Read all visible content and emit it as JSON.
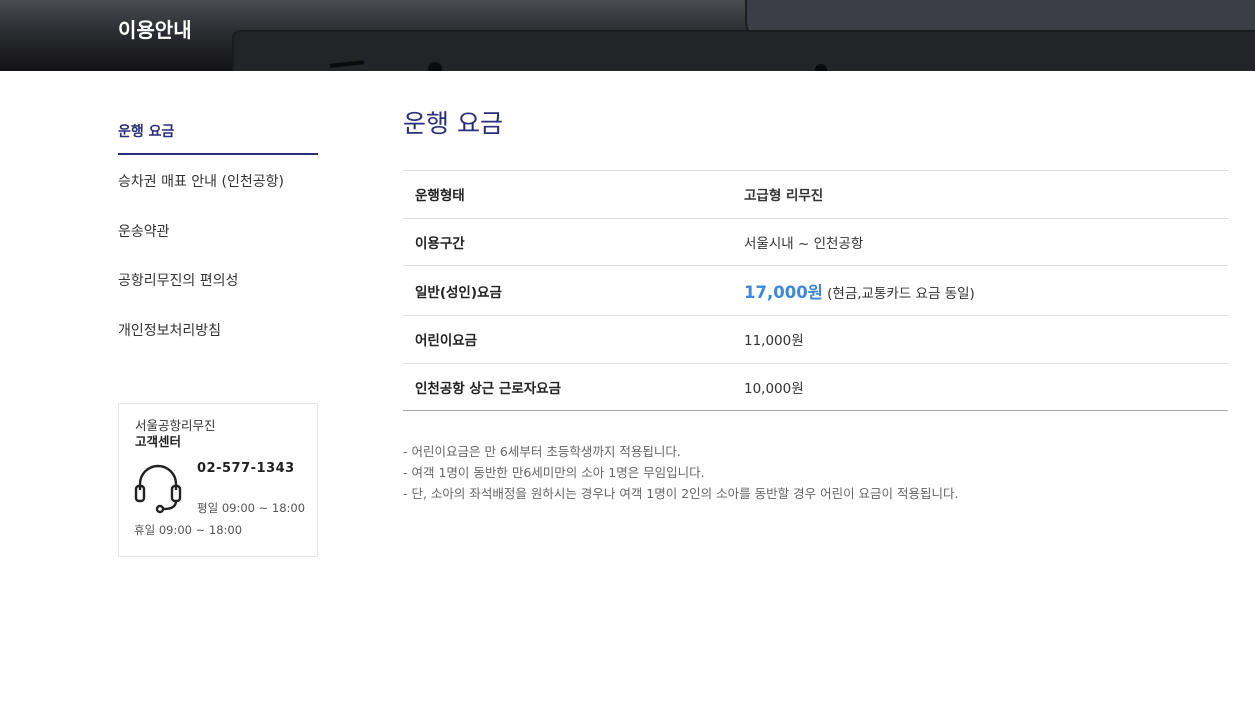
{
  "header": {
    "title": "이용안내"
  },
  "sidebar": {
    "items": [
      {
        "label": "운행 요금",
        "active": true
      },
      {
        "label": "승차권 매표 안내 (인천공항)",
        "active": false
      },
      {
        "label": "운송약관",
        "active": false
      },
      {
        "label": "공항리무진의 편의성",
        "active": false
      },
      {
        "label": "개인정보처리방침",
        "active": false
      }
    ]
  },
  "customer_service": {
    "company": "서울공항리무진",
    "center": "고객센터",
    "icon": "headset-icon",
    "phone": "02-577-1343",
    "weekday_hours": "평일 09:00 ~ 18:00",
    "holiday_hours": "휴일 09:00 ~ 18:00"
  },
  "main": {
    "title": "운행 요금",
    "table": {
      "rows": [
        {
          "label": "운행형태",
          "value": "고급형 리무진"
        },
        {
          "label": "이용구간",
          "value": "서울시내 ~ 인천공항"
        },
        {
          "label": "일반(성인)요금",
          "value": "17,000원",
          "note": "(현금,교통카드 요금 동일)"
        },
        {
          "label": "어린이요금",
          "value": "11,000원"
        },
        {
          "label": "인천공항 상근 근로자요금",
          "value": "10,000원"
        }
      ]
    },
    "notes": [
      "- 어린이요금은 만 6세부터 초등학생까지 적용됩니다.",
      "- 여객 1명이 동반한 만6세미만의 소아 1명은 무임입니다.",
      "- 단, 소아의 좌석배정을 원하시는 경우나 여객 1명이 2인의 소아를 동반할 경우 어린이 요금이 적용됩니다."
    ]
  },
  "colors": {
    "accent": "#2b2f7a",
    "price_highlight": "#3f87d8"
  }
}
